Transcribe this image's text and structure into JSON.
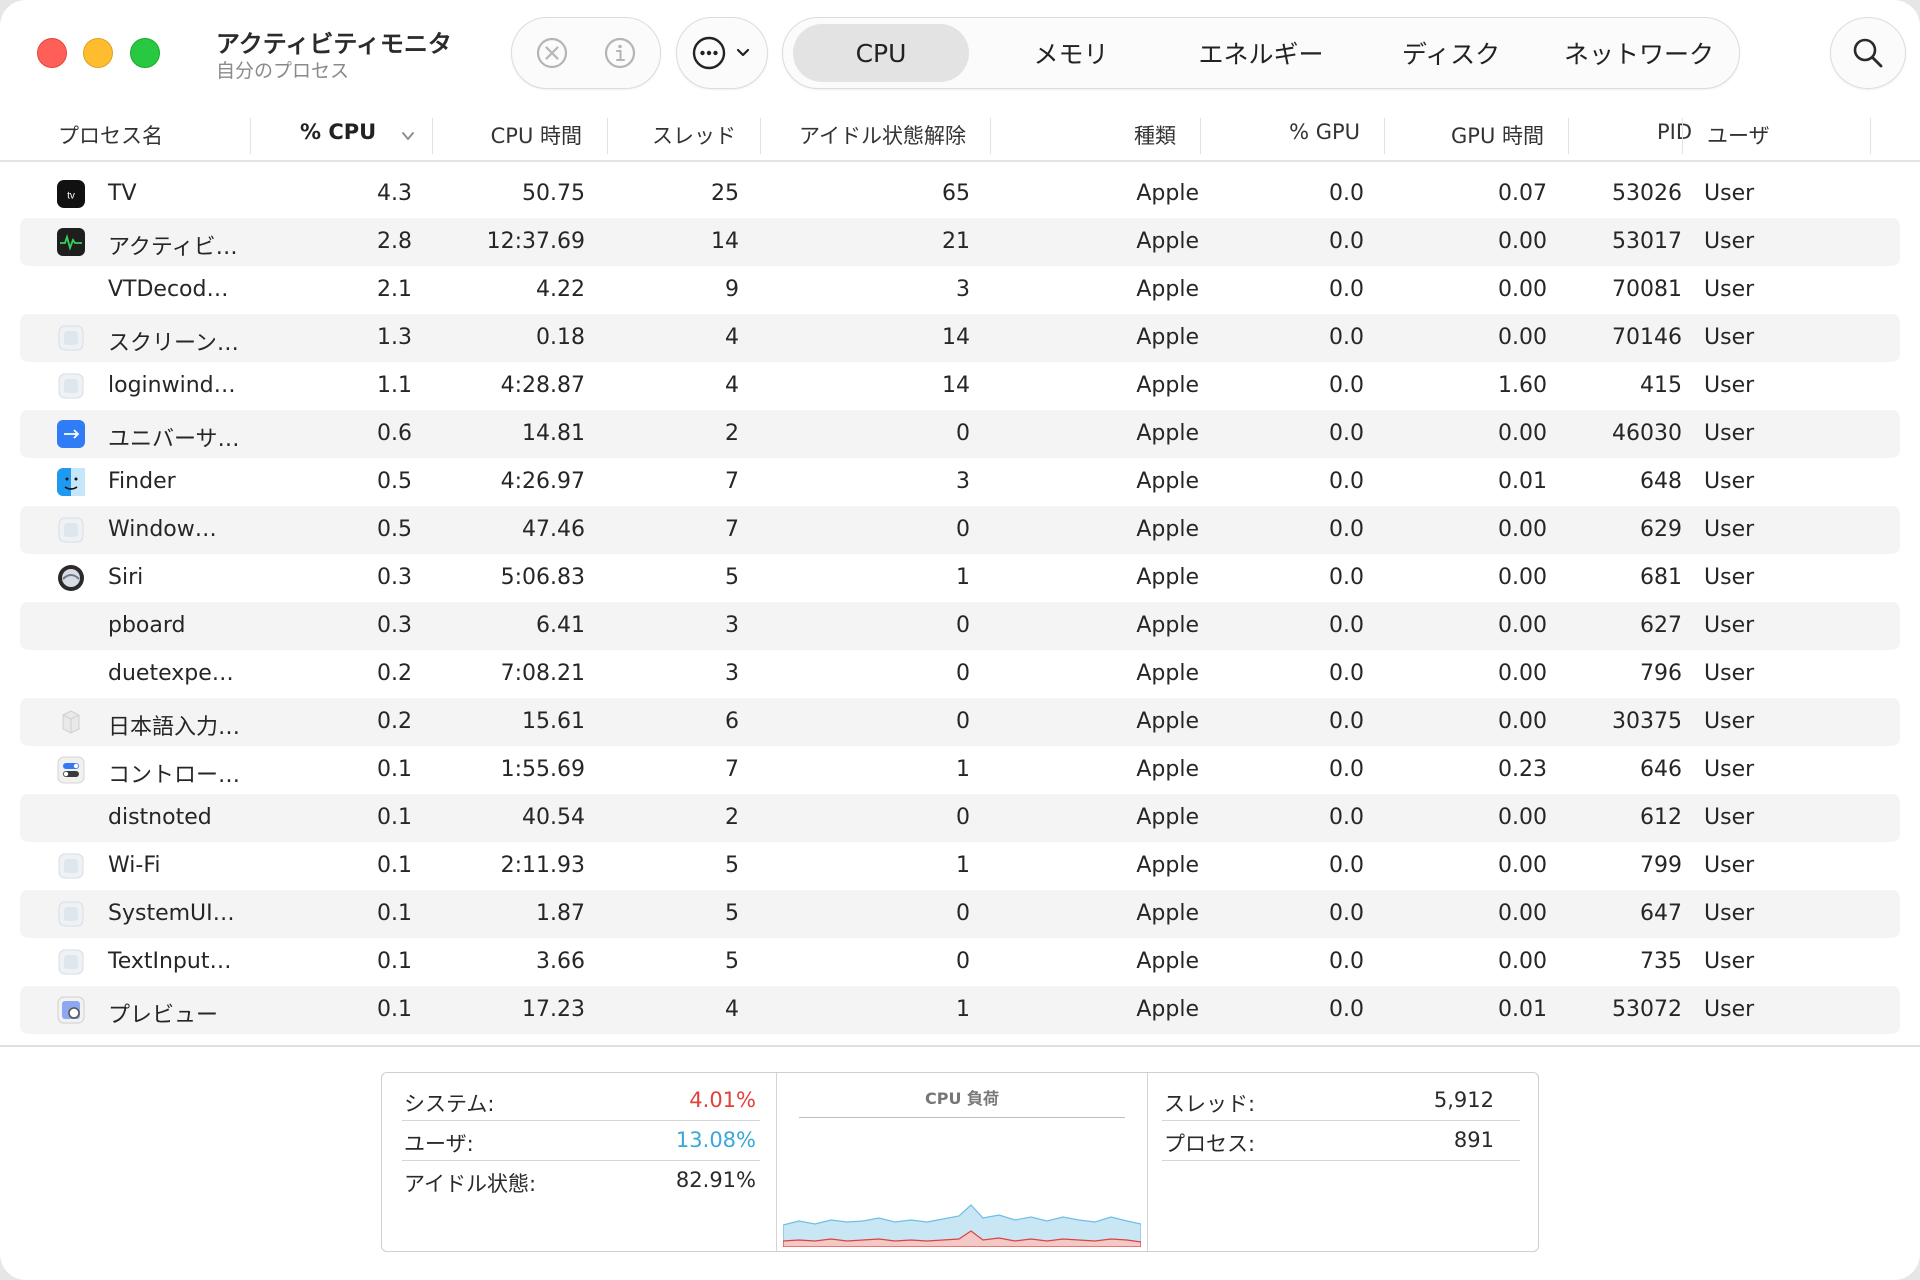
{
  "window": {
    "title": "アクティビティモニタ",
    "subtitle": "自分のプロセス"
  },
  "toolbar": {
    "stop_icon": "xmark-circle-icon",
    "info_icon": "info-circle-icon",
    "more_icon": "ellipsis-circle-icon",
    "search_icon": "magnifyingglass-icon",
    "tabs": [
      {
        "label": "CPU",
        "active": true
      },
      {
        "label": "メモリ",
        "active": false
      },
      {
        "label": "エネルギー",
        "active": false
      },
      {
        "label": "ディスク",
        "active": false
      },
      {
        "label": "ネットワーク",
        "active": false
      }
    ]
  },
  "table": {
    "columns": [
      "プロセス名",
      "% CPU",
      "CPU 時間",
      "スレッド",
      "アイドル状態解除",
      "種類",
      "% GPU",
      "GPU 時間",
      "PID",
      "ユーザ"
    ],
    "sorted_column": "% CPU",
    "rows": [
      {
        "name": "TV",
        "cpu": "4.3",
        "cpu_time": "50.75",
        "threads": "25",
        "idle_wakeups": "65",
        "kind": "Apple",
        "gpu": "0.0",
        "gpu_time": "0.07",
        "pid": "53026",
        "user": "User",
        "icon": "tv-app-icon"
      },
      {
        "name": "アクティビ…",
        "cpu": "2.8",
        "cpu_time": "12:37.69",
        "threads": "14",
        "idle_wakeups": "21",
        "kind": "Apple",
        "gpu": "0.0",
        "gpu_time": "0.00",
        "pid": "53017",
        "user": "User",
        "icon": "activity-monitor-icon"
      },
      {
        "name": "VTDecod…",
        "cpu": "2.1",
        "cpu_time": "4.22",
        "threads": "9",
        "idle_wakeups": "3",
        "kind": "Apple",
        "gpu": "0.0",
        "gpu_time": "0.00",
        "pid": "70081",
        "user": "User",
        "icon": ""
      },
      {
        "name": "スクリーン…",
        "cpu": "1.3",
        "cpu_time": "0.18",
        "threads": "4",
        "idle_wakeups": "14",
        "kind": "Apple",
        "gpu": "0.0",
        "gpu_time": "0.00",
        "pid": "70146",
        "user": "User",
        "icon": "generic-app-icon"
      },
      {
        "name": "loginwind…",
        "cpu": "1.1",
        "cpu_time": "4:28.87",
        "threads": "4",
        "idle_wakeups": "14",
        "kind": "Apple",
        "gpu": "0.0",
        "gpu_time": "1.60",
        "pid": "415",
        "user": "User",
        "icon": "generic-app-icon"
      },
      {
        "name": "ユニバーサ…",
        "cpu": "0.6",
        "cpu_time": "14.81",
        "threads": "2",
        "idle_wakeups": "0",
        "kind": "Apple",
        "gpu": "0.0",
        "gpu_time": "0.00",
        "pid": "46030",
        "user": "User",
        "icon": "universal-control-icon"
      },
      {
        "name": "Finder",
        "cpu": "0.5",
        "cpu_time": "4:26.97",
        "threads": "7",
        "idle_wakeups": "3",
        "kind": "Apple",
        "gpu": "0.0",
        "gpu_time": "0.01",
        "pid": "648",
        "user": "User",
        "icon": "finder-icon"
      },
      {
        "name": "Window…",
        "cpu": "0.5",
        "cpu_time": "47.46",
        "threads": "7",
        "idle_wakeups": "0",
        "kind": "Apple",
        "gpu": "0.0",
        "gpu_time": "0.00",
        "pid": "629",
        "user": "User",
        "icon": "generic-app-icon"
      },
      {
        "name": "Siri",
        "cpu": "0.3",
        "cpu_time": "5:06.83",
        "threads": "5",
        "idle_wakeups": "1",
        "kind": "Apple",
        "gpu": "0.0",
        "gpu_time": "0.00",
        "pid": "681",
        "user": "User",
        "icon": "siri-icon"
      },
      {
        "name": "pboard",
        "cpu": "0.3",
        "cpu_time": "6.41",
        "threads": "3",
        "idle_wakeups": "0",
        "kind": "Apple",
        "gpu": "0.0",
        "gpu_time": "0.00",
        "pid": "627",
        "user": "User",
        "icon": ""
      },
      {
        "name": "duetexpe…",
        "cpu": "0.2",
        "cpu_time": "7:08.21",
        "threads": "3",
        "idle_wakeups": "0",
        "kind": "Apple",
        "gpu": "0.0",
        "gpu_time": "0.00",
        "pid": "796",
        "user": "User",
        "icon": ""
      },
      {
        "name": "日本語入力…",
        "cpu": "0.2",
        "cpu_time": "15.61",
        "threads": "6",
        "idle_wakeups": "0",
        "kind": "Apple",
        "gpu": "0.0",
        "gpu_time": "0.00",
        "pid": "30375",
        "user": "User",
        "icon": "input-method-icon"
      },
      {
        "name": "コントロー…",
        "cpu": "0.1",
        "cpu_time": "1:55.69",
        "threads": "7",
        "idle_wakeups": "1",
        "kind": "Apple",
        "gpu": "0.0",
        "gpu_time": "0.23",
        "pid": "646",
        "user": "User",
        "icon": "control-center-icon"
      },
      {
        "name": "distnoted",
        "cpu": "0.1",
        "cpu_time": "40.54",
        "threads": "2",
        "idle_wakeups": "0",
        "kind": "Apple",
        "gpu": "0.0",
        "gpu_time": "0.00",
        "pid": "612",
        "user": "User",
        "icon": ""
      },
      {
        "name": "Wi-Fi",
        "cpu": "0.1",
        "cpu_time": "2:11.93",
        "threads": "5",
        "idle_wakeups": "1",
        "kind": "Apple",
        "gpu": "0.0",
        "gpu_time": "0.00",
        "pid": "799",
        "user": "User",
        "icon": "generic-app-icon"
      },
      {
        "name": "SystemUI…",
        "cpu": "0.1",
        "cpu_time": "1.87",
        "threads": "5",
        "idle_wakeups": "0",
        "kind": "Apple",
        "gpu": "0.0",
        "gpu_time": "0.00",
        "pid": "647",
        "user": "User",
        "icon": "generic-app-icon"
      },
      {
        "name": "TextInput…",
        "cpu": "0.1",
        "cpu_time": "3.66",
        "threads": "5",
        "idle_wakeups": "0",
        "kind": "Apple",
        "gpu": "0.0",
        "gpu_time": "0.00",
        "pid": "735",
        "user": "User",
        "icon": "generic-app-icon"
      },
      {
        "name": "プレビュー",
        "cpu": "0.1",
        "cpu_time": "17.23",
        "threads": "4",
        "idle_wakeups": "1",
        "kind": "Apple",
        "gpu": "0.0",
        "gpu_time": "0.01",
        "pid": "53072",
        "user": "User",
        "icon": "preview-icon"
      }
    ]
  },
  "summary": {
    "system_label": "システム:",
    "system_value": "4.01%",
    "user_label": "ユーザ:",
    "user_value": "13.08%",
    "idle_label": "アイドル状態:",
    "idle_value": "82.91%",
    "chart_title": "CPU 負荷",
    "threads_label": "スレッド:",
    "threads_value": "5,912",
    "processes_label": "プロセス:",
    "processes_value": "891"
  },
  "colors": {
    "system": "#e0413b",
    "user": "#3aa8d8",
    "user_fill": "#c9e6f5",
    "accent_red": "#ff5f57",
    "accent_yellow": "#febc2e",
    "accent_green": "#28c840"
  }
}
